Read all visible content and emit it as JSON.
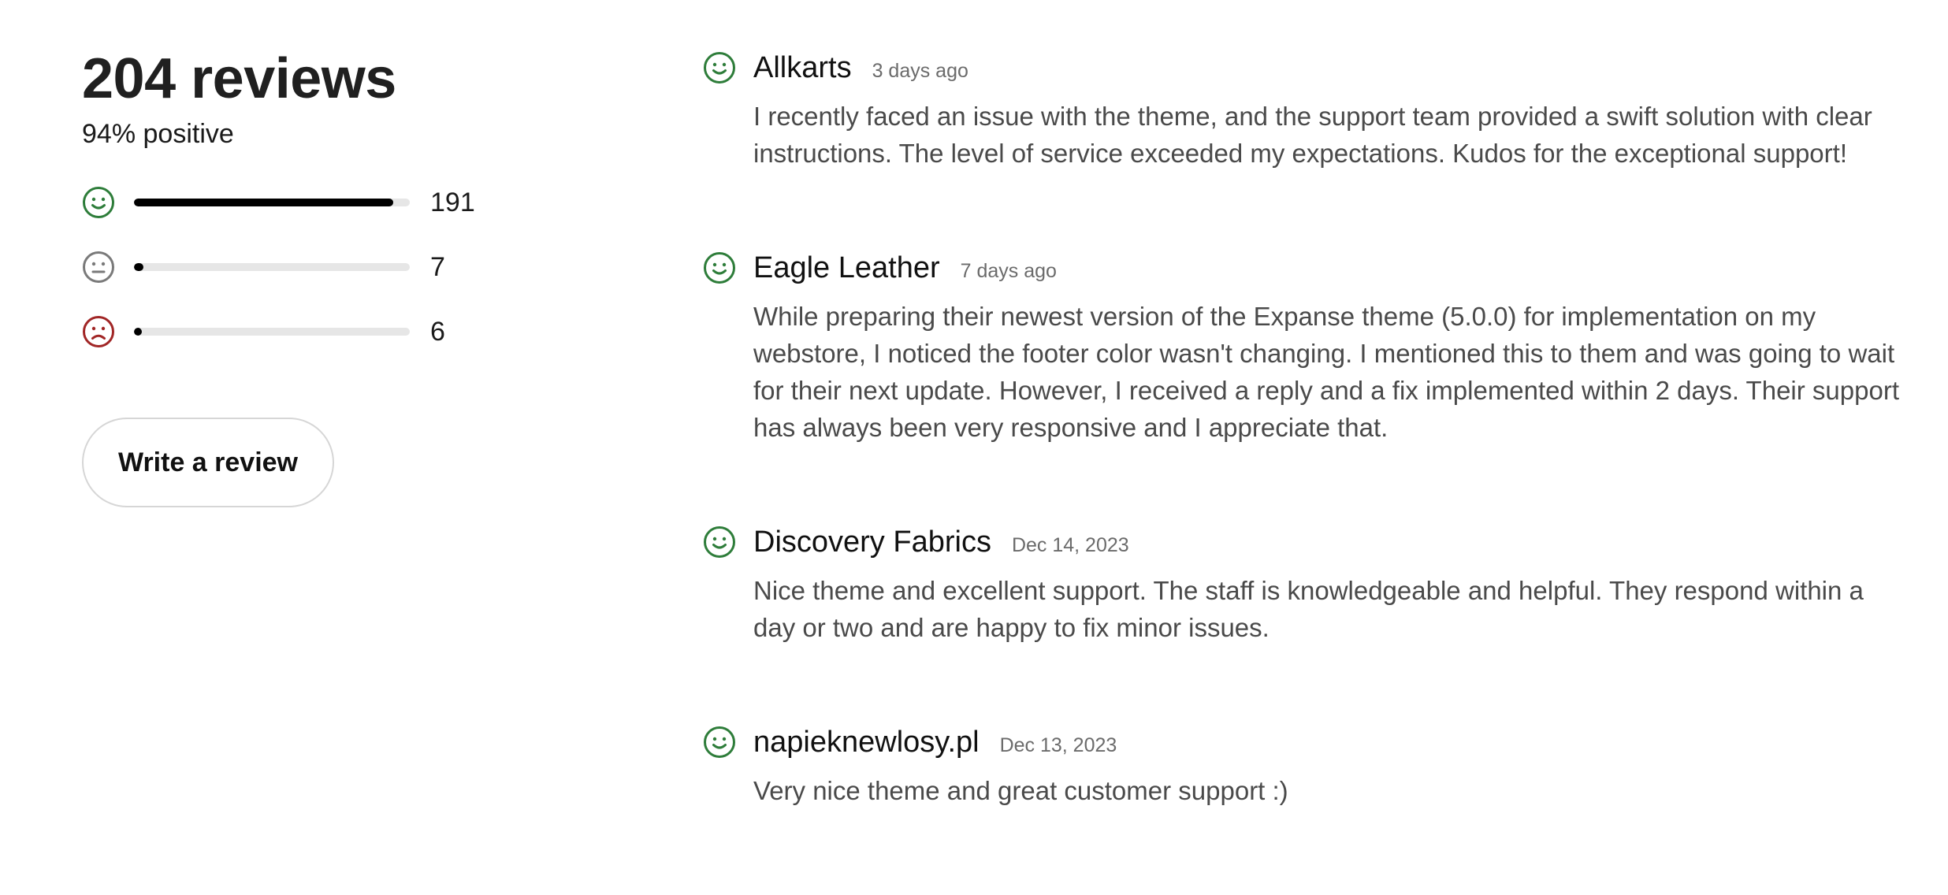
{
  "summary": {
    "title": "204 reviews",
    "subtitle": "94% positive",
    "ratings": [
      {
        "sentiment": "positive",
        "icon": "happy-face-icon",
        "count": "191",
        "fraction": 0.94,
        "color": "#2e7d3a"
      },
      {
        "sentiment": "neutral",
        "icon": "neutral-face-icon",
        "count": "7",
        "fraction": 0.034,
        "color": "#7a7a7a"
      },
      {
        "sentiment": "negative",
        "icon": "sad-face-icon",
        "count": "6",
        "fraction": 0.029,
        "color": "#a12626"
      }
    ],
    "write_review_label": "Write a review"
  },
  "reviews": [
    {
      "author": "Allkarts",
      "date": "3 days ago",
      "sentiment": "positive",
      "icon": "happy-face-icon",
      "text": "I recently faced an issue with the theme, and the support team provided a swift solution with clear instructions. The level of service exceeded my expectations. Kudos for the exceptional support!"
    },
    {
      "author": "Eagle Leather",
      "date": "7 days ago",
      "sentiment": "positive",
      "icon": "happy-face-icon",
      "text": "While preparing their newest version of the Expanse theme (5.0.0) for implementation on my webstore, I noticed the footer color wasn't changing. I mentioned this to them and was going to wait for their next update. However, I received a reply and a fix implemented within 2 days. Their support has always been very responsive and I appreciate that."
    },
    {
      "author": "Discovery Fabrics",
      "date": "Dec 14, 2023",
      "sentiment": "positive",
      "icon": "happy-face-icon",
      "text": "Nice theme and excellent support. The staff is knowledgeable and helpful. They respond within a day or two and are happy to fix minor issues."
    },
    {
      "author": "napieknewlosy.pl",
      "date": "Dec 13, 2023",
      "sentiment": "positive",
      "icon": "happy-face-icon",
      "text": "Very nice theme and great customer support :)"
    }
  ]
}
